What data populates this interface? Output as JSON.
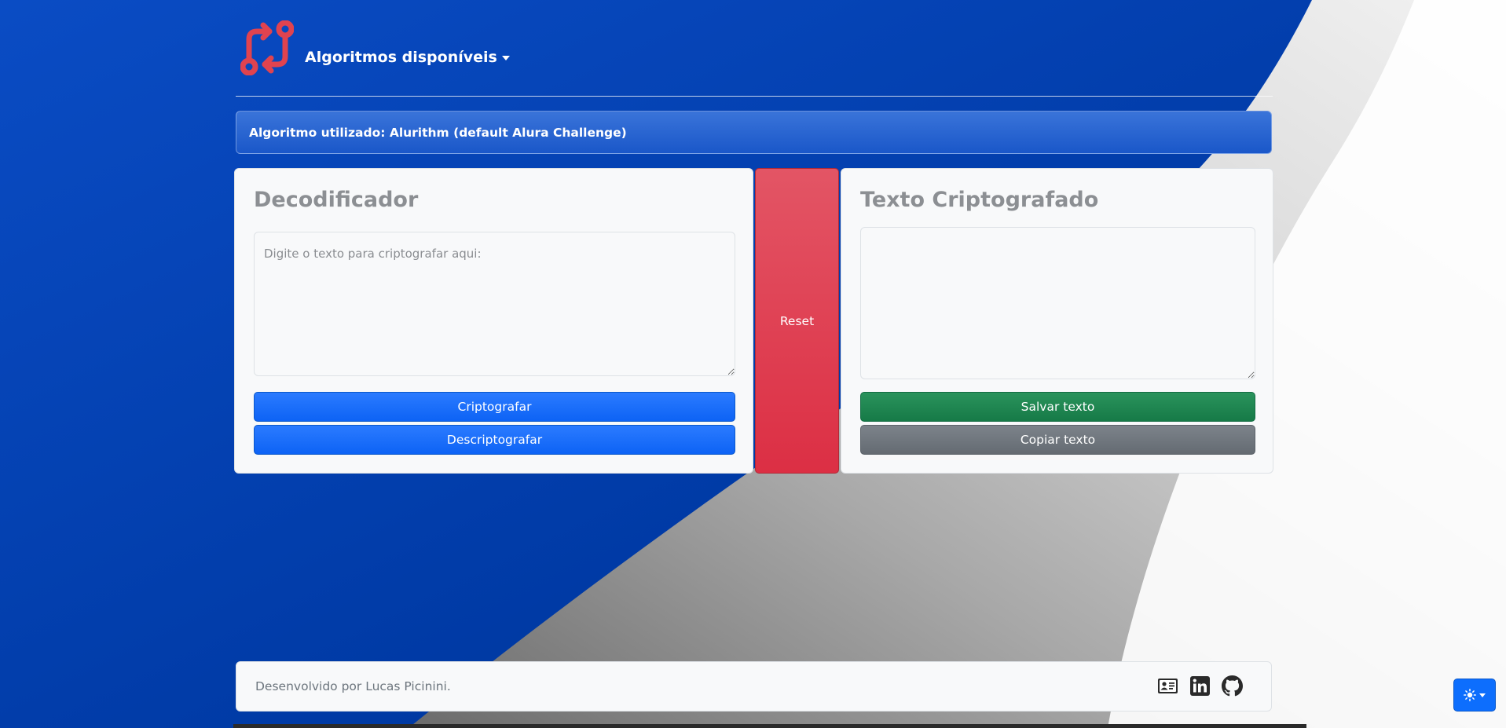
{
  "nav": {
    "logo_icon": "git-compare-icon",
    "logo_color": "#e0434f",
    "dropdown_label": "Algoritmos disponíveis"
  },
  "alert": {
    "text": "Algoritmo utilizado: Alurithm (default Alura Challenge)"
  },
  "decoder": {
    "title": "Decodificador",
    "input_placeholder": "Digite o texto para criptografar aqui:",
    "input_value": "",
    "encrypt_label": "Criptografar",
    "decrypt_label": "Descriptografar"
  },
  "reset": {
    "label": "Reset"
  },
  "output": {
    "title": "Texto Criptografado",
    "value": "",
    "save_label": "Salvar texto",
    "copy_label": "Copiar texto"
  },
  "footer": {
    "text": "Desenvolvido por Lucas Picinini.",
    "icons": [
      "id-card-icon",
      "linkedin-icon",
      "github-icon"
    ]
  },
  "theme_toggle": {
    "icon": "sun-icon"
  },
  "colors": {
    "background_blue": "#0039a6",
    "primary": "#0d6efd",
    "danger": "#dc3545",
    "success": "#198754",
    "secondary": "#6c757d"
  }
}
